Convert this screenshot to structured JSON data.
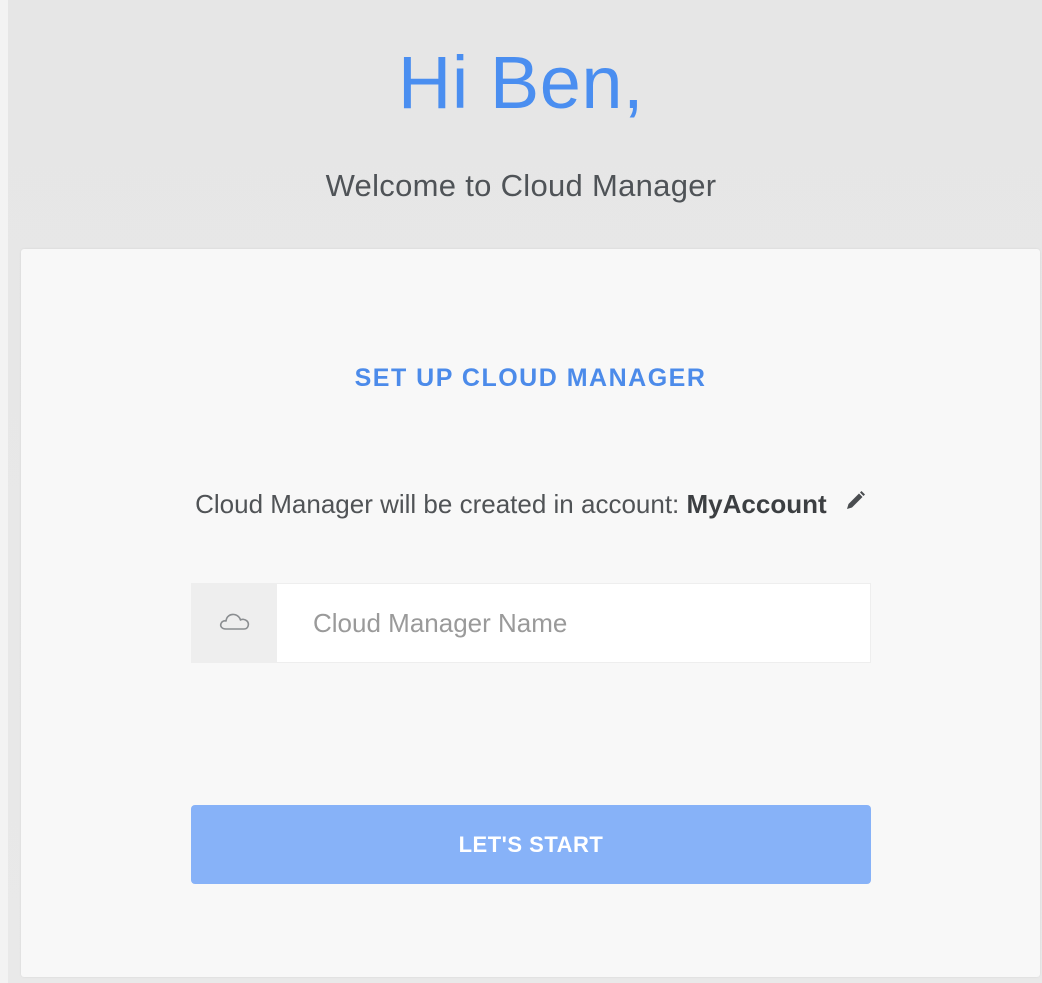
{
  "header": {
    "greeting": "Hi Ben,",
    "welcome": "Welcome to Cloud Manager"
  },
  "setup": {
    "title": "SET UP CLOUD MANAGER",
    "account_prefix": "Cloud Manager will be created in account:",
    "account_name": "MyAccount",
    "edit_icon": "pencil-icon",
    "field_icon": "cloud-icon",
    "name_placeholder": "Cloud Manager Name",
    "name_value": "",
    "start_label": "LET'S START"
  },
  "colors": {
    "accent": "#4a8ef0",
    "button": "#87b2f8",
    "background": "#e8e8e8",
    "card": "#f8f8f8"
  }
}
